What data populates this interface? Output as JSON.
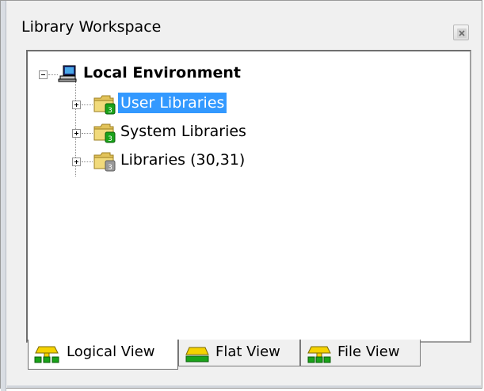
{
  "window": {
    "title": "Library Workspace"
  },
  "tree": {
    "root": {
      "label": "Local Environment",
      "icon": "computer-icon"
    },
    "children": [
      {
        "label": "User Libraries",
        "icon": "folder-green-database-icon",
        "selected": true
      },
      {
        "label": "System Libraries",
        "icon": "folder-green-database-icon",
        "selected": false
      },
      {
        "label": "Libraries (30,31)",
        "icon": "folder-gray-database-icon",
        "selected": false
      }
    ]
  },
  "tabs": [
    {
      "label": "Logical View",
      "icon": "logical-view-icon",
      "active": true
    },
    {
      "label": "Flat View",
      "icon": "flat-view-icon",
      "active": false
    },
    {
      "label": "File View",
      "icon": "file-view-icon",
      "active": false
    }
  ],
  "colors": {
    "selection": "#3399ff",
    "folder": "#e2c35a",
    "db_green": "#1aa31a",
    "db_gray": "#8c8c8c"
  }
}
